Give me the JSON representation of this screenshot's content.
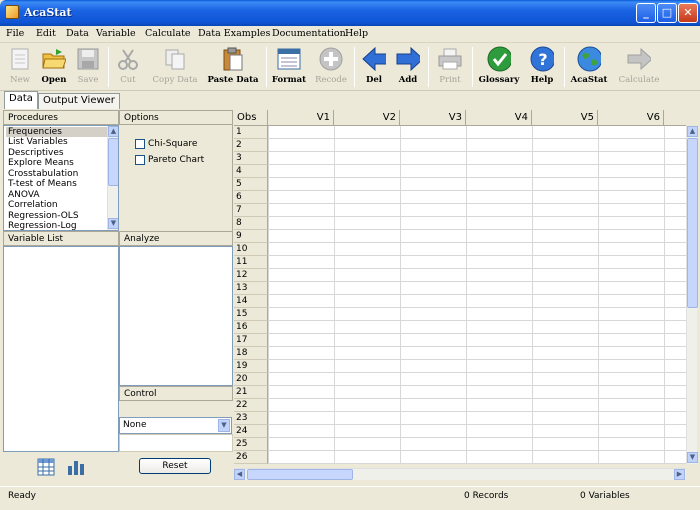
{
  "window": {
    "title": "AcaStat",
    "minimize": "_",
    "maximize": "□",
    "close": "✕"
  },
  "menu": [
    "File",
    "Edit",
    "Data",
    "Variable",
    "Calculate",
    "Data Examples",
    "Documentation",
    "Help"
  ],
  "toolbar": [
    {
      "label": "New",
      "enabled": false,
      "icon": "new-document-icon"
    },
    {
      "label": "Open",
      "enabled": true,
      "icon": "open-folder-icon"
    },
    {
      "label": "Save",
      "enabled": false,
      "icon": "save-disk-icon"
    },
    {
      "label": "Cut",
      "enabled": false,
      "icon": "scissors-icon"
    },
    {
      "label": "Copy Data",
      "enabled": false,
      "icon": "copy-icon"
    },
    {
      "label": "Paste Data",
      "enabled": true,
      "icon": "paste-clipboard-icon"
    },
    {
      "label": "Format",
      "enabled": true,
      "icon": "format-window-icon"
    },
    {
      "label": "Recode",
      "enabled": false,
      "icon": "recode-plus-icon"
    },
    {
      "label": "Del",
      "enabled": true,
      "icon": "arrow-left-icon"
    },
    {
      "label": "Add",
      "enabled": true,
      "icon": "arrow-right-icon"
    },
    {
      "label": "Print",
      "enabled": false,
      "icon": "printer-icon"
    },
    {
      "label": "Glossary",
      "enabled": true,
      "icon": "checkmark-icon"
    },
    {
      "label": "Help",
      "enabled": true,
      "icon": "question-icon"
    },
    {
      "label": "AcaStat",
      "enabled": true,
      "icon": "globe-icon"
    },
    {
      "label": "Calculate",
      "enabled": false,
      "icon": "calculate-arrow-icon"
    }
  ],
  "tabs": [
    {
      "label": "Data",
      "active": true
    },
    {
      "label": "Output Viewer",
      "active": false
    }
  ],
  "procedures": {
    "header": "Procedures",
    "items": [
      "Frequencies",
      "List Variables",
      "Descriptives",
      "Explore Means",
      "Crosstabulation",
      "T-test of Means",
      "ANOVA",
      "Correlation",
      "Regression-OLS",
      "Regression-Log"
    ],
    "selected": "Frequencies"
  },
  "options": {
    "header": "Options",
    "items": [
      {
        "label": "Chi-Square",
        "checked": false
      },
      {
        "label": "Pareto Chart",
        "checked": false
      }
    ]
  },
  "variable_list": {
    "header": "Variable List"
  },
  "analyze": {
    "header": "Analyze"
  },
  "control": {
    "header": "Control",
    "select_value": "None",
    "reset_label": "Reset"
  },
  "grid": {
    "obs_header": "Obs",
    "columns": [
      "V1",
      "V2",
      "V3",
      "V4",
      "V5",
      "V6"
    ],
    "rows": [
      "1",
      "2",
      "3",
      "4",
      "5",
      "6",
      "7",
      "8",
      "9",
      "10",
      "11",
      "12",
      "13",
      "14",
      "15",
      "16",
      "17",
      "18",
      "19",
      "20",
      "21",
      "22",
      "23",
      "24",
      "25",
      "26"
    ]
  },
  "status": {
    "ready": "Ready",
    "records": "0 Records",
    "variables": "0 Variables"
  },
  "colors": {
    "titlebar": "#1a63e3",
    "panel": "#ece9d8",
    "border": "#7f9db9"
  }
}
